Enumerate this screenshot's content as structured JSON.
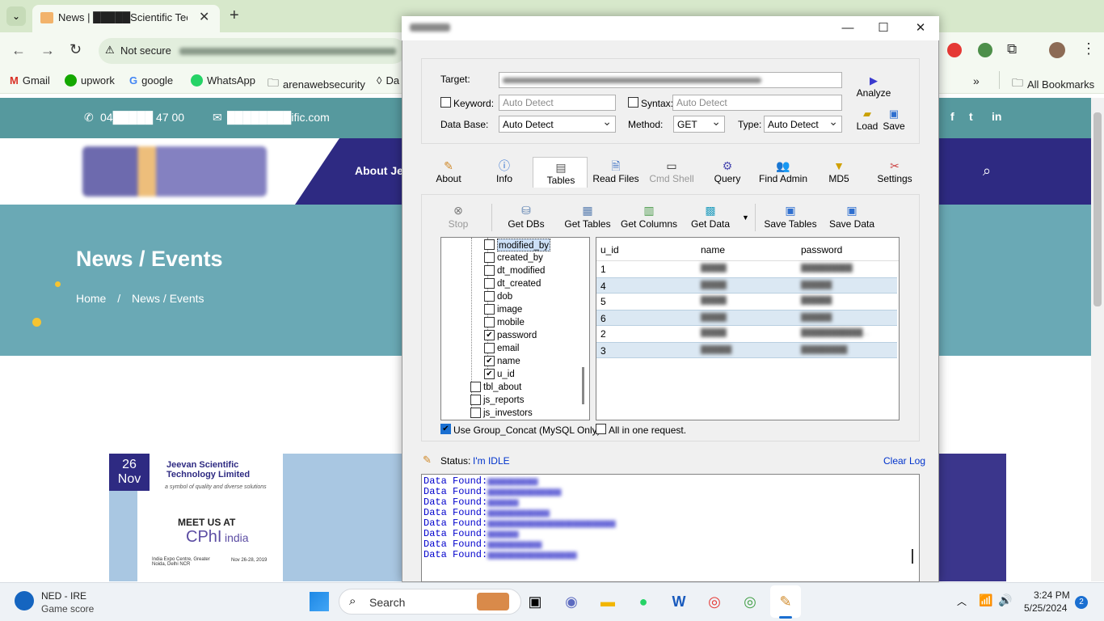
{
  "browser": {
    "tab_title": "News | █████Scientific Techno",
    "security": "Not secure",
    "bookmarks": [
      "Gmail",
      "upwork",
      "google",
      "WhatsApp",
      "arenawebsecurity",
      "Da"
    ],
    "all_bookmarks": "All Bookmarks"
  },
  "site": {
    "phone": "04█████ 47 00",
    "email": "████████ific.com",
    "nav_about": "About Jee",
    "hero_title": "News / Events",
    "crumb_home": "Home",
    "crumb_sep": "/",
    "crumb_current": "News / Events",
    "event_day": "26",
    "event_month": "Nov",
    "flyer_company": "Jeevan Scientific Technology Limited",
    "flyer_tagline": "a symbol of quality and diverse solutions",
    "flyer_meet": "MEET US AT",
    "flyer_cphi": "CPhI",
    "flyer_india": "india",
    "flyer_venue": "India Expo Centre, Greater Noida, Delhi NCR",
    "flyer_dates": "Nov 26-28, 2019"
  },
  "app": {
    "target_label": "Target:",
    "keyword_label": "Keyword:",
    "keyword_value": "Auto Detect",
    "syntax_label": "Syntax:",
    "syntax_value": "Auto Detect",
    "database_label": "Data Base:",
    "database_value": "Auto Detect",
    "method_label": "Method:",
    "method_value": "GET",
    "type_label": "Type:",
    "type_value": "Auto Detect",
    "analyze": "Analyze",
    "load": "Load",
    "save": "Save",
    "tabs": [
      "About",
      "Info",
      "Tables",
      "Read Files",
      "Cmd Shell",
      "Query",
      "Find Admin",
      "MD5",
      "Settings"
    ],
    "stop": "Stop",
    "get_dbs": "Get DBs",
    "get_tables": "Get Tables",
    "get_columns": "Get Columns",
    "get_data": "Get Data",
    "save_tables": "Save Tables",
    "save_data": "Save Data",
    "tree_columns": [
      {
        "name": "modified_by",
        "checked": false
      },
      {
        "name": "created_by",
        "checked": false
      },
      {
        "name": "dt_modified",
        "checked": false
      },
      {
        "name": "dt_created",
        "checked": false
      },
      {
        "name": "dob",
        "checked": false
      },
      {
        "name": "image",
        "checked": false
      },
      {
        "name": "mobile",
        "checked": false
      },
      {
        "name": "password",
        "checked": true
      },
      {
        "name": "email",
        "checked": false
      },
      {
        "name": "name",
        "checked": true
      },
      {
        "name": "u_id",
        "checked": true
      }
    ],
    "tree_tables": [
      "tbl_about",
      "js_reports",
      "js_investors"
    ],
    "use_group_concat": "Use Group_Concat (MySQL Only)",
    "all_in_one": "All in one request.",
    "grid_headers": [
      "u_id",
      "name",
      "password"
    ],
    "grid_rows": [
      {
        "u_id": "1",
        "name": "█████",
        "password": "██████████"
      },
      {
        "u_id": "4",
        "name": "█████",
        "password": "██████"
      },
      {
        "u_id": "5",
        "name": "█████",
        "password": "██████"
      },
      {
        "u_id": "6",
        "name": "█████",
        "password": "██████"
      },
      {
        "u_id": "2",
        "name": "█████",
        "password": "████████████..."
      },
      {
        "u_id": "3",
        "name": "██████",
        "password": "█████████"
      }
    ],
    "status_label": "Status:",
    "status_value": "I'm IDLE",
    "clear_log": "Clear Log",
    "log_prefix": "Data Found:",
    "log_lines": [
      "█████████████",
      "███████████████████",
      "████████",
      "████████████████",
      "█████████████████████████████████",
      "████████",
      "██████████████",
      "███████████████████████"
    ]
  },
  "taskbar": {
    "weather_title": "NED - IRE",
    "weather_sub": "Game score",
    "search": "Search",
    "time": "3:24 PM",
    "date": "5/25/2024",
    "notif_count": "2"
  },
  "colors": {
    "nav_blue": "#2e2a82",
    "topbar_teal": "#56999e",
    "log_blue": "#0000cc",
    "status_blue": "#0033cc"
  }
}
